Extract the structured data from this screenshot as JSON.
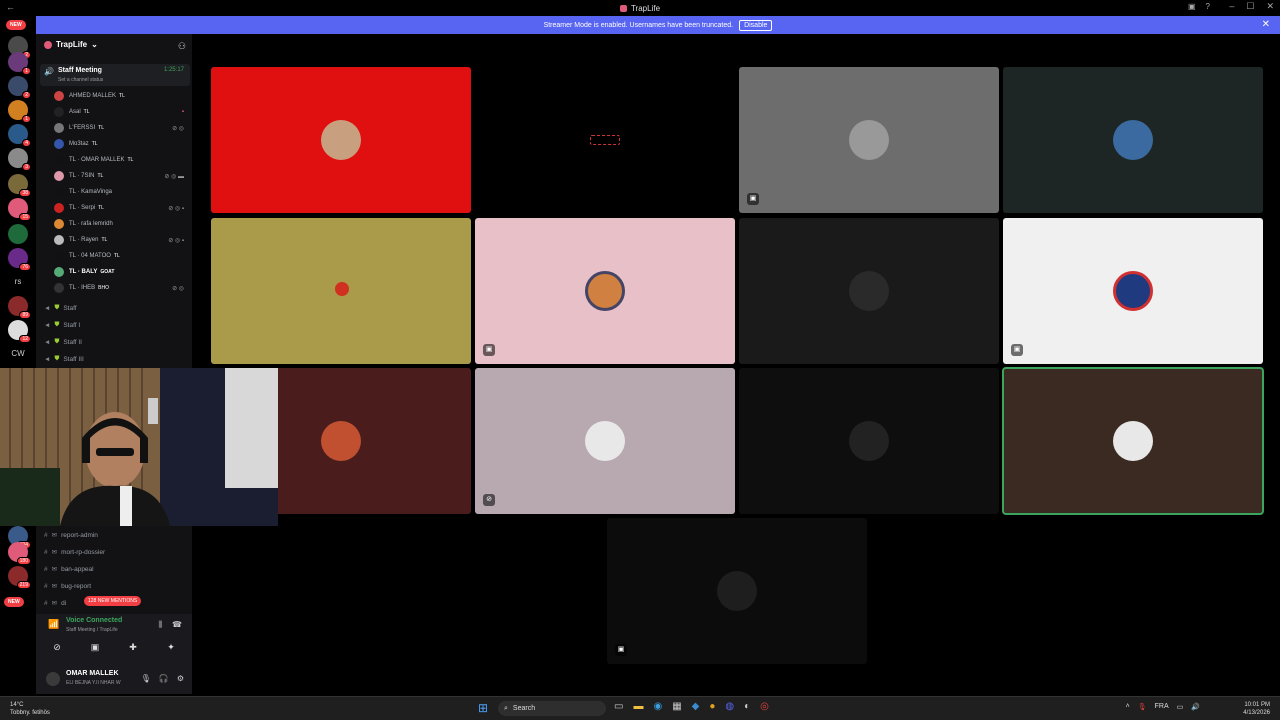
{
  "window": {
    "title": "TrapLife"
  },
  "banner": {
    "text": "Streamer Mode is enabled. Usernames have been truncated.",
    "disable_label": "Disable"
  },
  "rail": {
    "new_label": "NEW",
    "text_servers": [
      "rs",
      "CW"
    ]
  },
  "server": {
    "name": "TrapLife"
  },
  "voice_channel": {
    "name": "Staff Meeting",
    "timer": "1:25:17",
    "status_placeholder": "Set a channel status"
  },
  "members": [
    {
      "name": "AHMED MALLEK",
      "tag": "TL"
    },
    {
      "name": "Asal",
      "tag": "TL"
    },
    {
      "name": "L'FERSSI",
      "tag": "TL"
    },
    {
      "name": "Mo3taz",
      "tag": "TL"
    },
    {
      "name": "TL · OMAR MALLEK",
      "tag": "TL"
    },
    {
      "name": "TL · 7SIN",
      "tag": "TL"
    },
    {
      "name": "TL · KamaVinga",
      "tag": ""
    },
    {
      "name": "TL · Serpi",
      "tag": "TL"
    },
    {
      "name": "TL · rafa lemridh",
      "tag": ""
    },
    {
      "name": "TL · Rayen",
      "tag": "TL"
    },
    {
      "name": "TL · 04 MATOO",
      "tag": "TL"
    },
    {
      "name": "TL · BALY",
      "tag": "GOAT"
    },
    {
      "name": "TL · IHEB",
      "tag": "BHO"
    }
  ],
  "staff_channels": [
    "Staff",
    "Staff I",
    "Staff II",
    "Staff III"
  ],
  "text_channels": [
    "report-admin",
    "mort-rp-dossier",
    "ban-appeal",
    "bug-report",
    "di"
  ],
  "mentions_label": "128 NEW MENTIONS",
  "voice_panel": {
    "status": "Voice Connected",
    "location": "Staff Meeting / TrapLife"
  },
  "user": {
    "name": "OMAR MALLEK",
    "status": "ELI BEJNA Y.II NHAR W"
  },
  "taskbar": {
    "temperature": "14°C",
    "weather": "Tobbny. fetihös",
    "search_placeholder": "Search",
    "language": "FRA",
    "time": "10:01 PM",
    "date": "4/13/2026"
  },
  "colors": {
    "accent": "#5865f2",
    "online": "#3ba55d",
    "danger": "#f23f43"
  }
}
